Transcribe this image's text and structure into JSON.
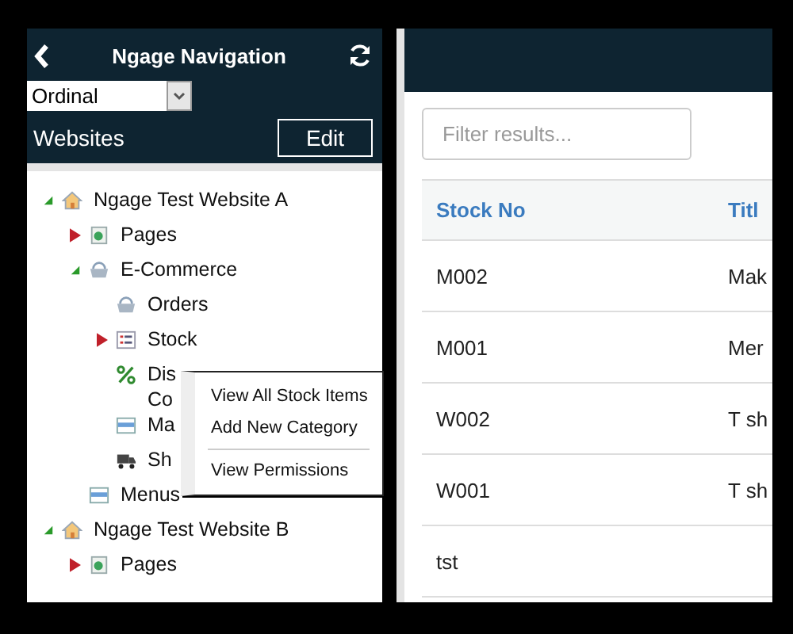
{
  "nav": {
    "title": "Ngage Navigation",
    "select": {
      "value": "Ordinal"
    },
    "section_label": "Websites",
    "edit_button": "Edit"
  },
  "tree": [
    {
      "label": "Ngage Test Website A",
      "kind": "home",
      "expanded": true,
      "children": [
        {
          "label": "Pages",
          "kind": "page",
          "expanded": false
        },
        {
          "label": "E-Commerce",
          "kind": "basket",
          "expanded": true,
          "children": [
            {
              "label": "Orders",
              "kind": "basket"
            },
            {
              "label": "Stock",
              "kind": "list",
              "expanded": false
            },
            {
              "label": "Dis\nCo",
              "kind": "percent"
            },
            {
              "label": "Ma",
              "kind": "menu"
            },
            {
              "label": "Sh",
              "kind": "truck"
            }
          ]
        },
        {
          "label": "Menus",
          "kind": "menu"
        }
      ]
    },
    {
      "label": "Ngage Test Website B",
      "kind": "home",
      "expanded": true,
      "children": [
        {
          "label": "Pages",
          "kind": "page",
          "expanded": false
        }
      ]
    }
  ],
  "context_menu": [
    {
      "label": "View All Stock Items",
      "kind": "item"
    },
    {
      "label": "Add New Category",
      "kind": "item"
    },
    {
      "kind": "separator"
    },
    {
      "label": "View Permissions",
      "kind": "item"
    }
  ],
  "filter": {
    "placeholder": "Filter results..."
  },
  "table": {
    "columns": [
      "Stock No",
      "Titl"
    ],
    "rows": [
      [
        "M002",
        "Mak"
      ],
      [
        "M001",
        "Mer"
      ],
      [
        "W002",
        "T sh"
      ],
      [
        "W001",
        "T sh"
      ],
      [
        "tst",
        ""
      ]
    ]
  }
}
